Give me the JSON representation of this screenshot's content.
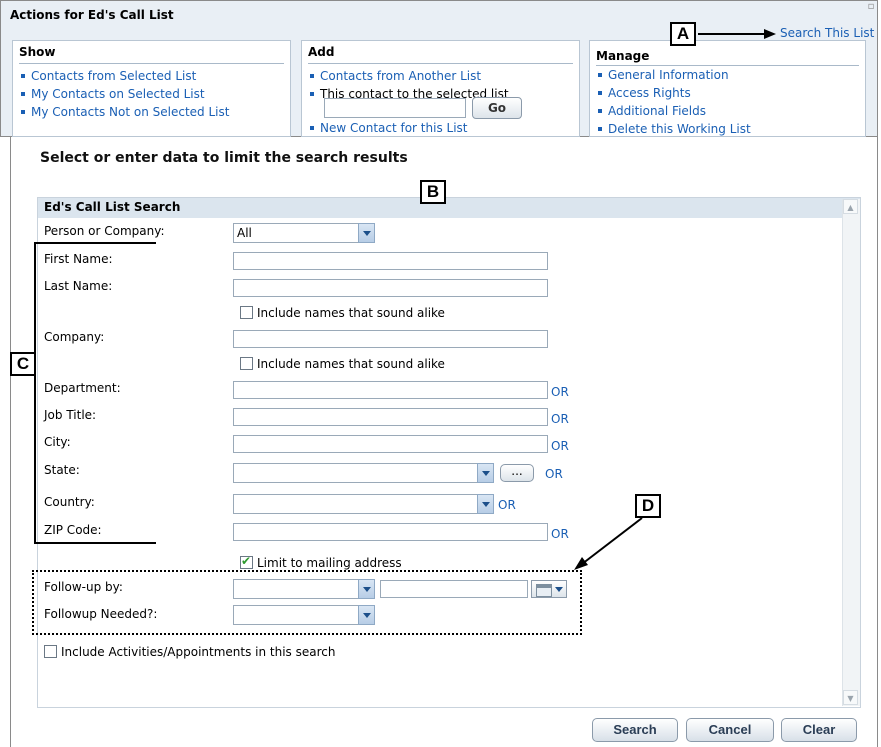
{
  "top_panel": {
    "title": "Actions for Ed's Call List",
    "search_link": "Search This List",
    "show": {
      "heading": "Show",
      "items": [
        "Contacts from Selected List",
        "My Contacts on Selected List",
        "My Contacts Not on Selected List"
      ]
    },
    "add": {
      "heading": "Add",
      "items": [
        "Contacts from Another List",
        "This contact to the selected list"
      ],
      "go_label": "Go",
      "new_contact": "New Contact for this List"
    },
    "manage": {
      "heading": "Manage",
      "items": [
        "General Information",
        "Access Rights",
        "Additional Fields",
        "Delete this Working List"
      ]
    }
  },
  "callouts": {
    "a": "A",
    "b": "B",
    "c": "C",
    "d": "D"
  },
  "main": {
    "heading": "Select or enter data to limit the search results",
    "panel_title": "Ed's Call List Search",
    "person_or_company": {
      "label": "Person or Company:",
      "value": "All"
    },
    "first_name": {
      "label": "First Name:",
      "value": ""
    },
    "last_name": {
      "label": "Last Name:",
      "value": ""
    },
    "sound_alike_1": {
      "label": "Include names that sound alike",
      "checked": false
    },
    "company": {
      "label": "Company:",
      "value": ""
    },
    "sound_alike_2": {
      "label": "Include names that sound alike",
      "checked": false
    },
    "department": {
      "label": "Department:",
      "value": ""
    },
    "job_title": {
      "label": "Job Title:",
      "value": ""
    },
    "city": {
      "label": "City:",
      "value": ""
    },
    "state": {
      "label": "State:",
      "value": "",
      "more_label": "..."
    },
    "country": {
      "label": "Country:",
      "value": ""
    },
    "zip_code": {
      "label": "ZIP Code:",
      "value": ""
    },
    "or_label": "OR",
    "limit_mailing": {
      "label": "Limit to mailing address",
      "checked": true
    },
    "followup_by": {
      "label": "Follow-up by:",
      "value": "",
      "date_value": ""
    },
    "followup_needed": {
      "label": "Followup Needed?:",
      "value": ""
    },
    "include_activities": {
      "label": "Include Activities/Appointments in this search",
      "checked": false
    }
  },
  "buttons": {
    "search": "Search",
    "cancel": "Cancel",
    "clear": "Clear"
  },
  "colors": {
    "link": "#1a5fb4",
    "panel_bg": "#e9eff5",
    "header_bg": "#dbe5ee",
    "check": "#2e9a2e"
  }
}
